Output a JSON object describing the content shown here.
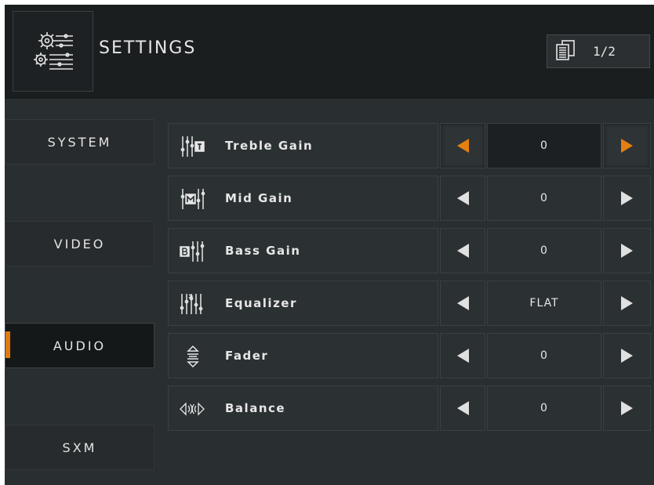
{
  "header": {
    "title": "SETTINGS",
    "page_indicator": "1/2",
    "icon": "settings-gears-icon",
    "page_icon": "page-list-icon"
  },
  "sidebar": {
    "items": [
      {
        "label": "SYSTEM",
        "active": false
      },
      {
        "label": "VIDEO",
        "active": false
      },
      {
        "label": "AUDIO",
        "active": true
      },
      {
        "label": "SXM",
        "active": false
      }
    ]
  },
  "rows": [
    {
      "label": "Treble Gain",
      "value": "0",
      "icon": "treble-gain-icon",
      "selected": true
    },
    {
      "label": "Mid Gain",
      "value": "0",
      "icon": "mid-gain-icon",
      "selected": false
    },
    {
      "label": "Bass Gain",
      "value": "0",
      "icon": "bass-gain-icon",
      "selected": false
    },
    {
      "label": "Equalizer",
      "value": "FLAT",
      "icon": "equalizer-icon",
      "selected": false
    },
    {
      "label": "Fader",
      "value": "0",
      "icon": "fader-icon",
      "selected": false
    },
    {
      "label": "Balance",
      "value": "0",
      "icon": "balance-icon",
      "selected": false
    }
  ],
  "colors": {
    "accent": "#e57f12",
    "background": "#292e30",
    "header": "#1b1e1f"
  }
}
